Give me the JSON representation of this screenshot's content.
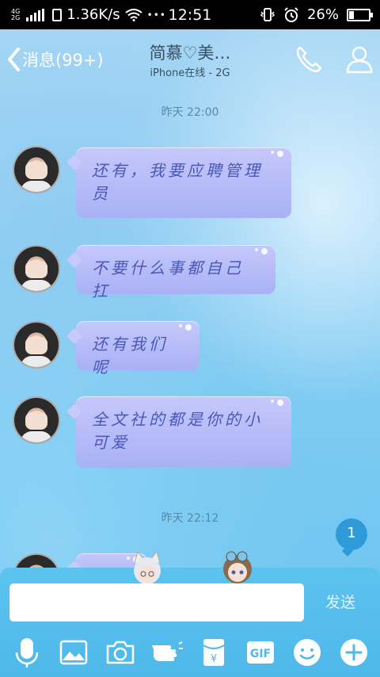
{
  "status_bar": {
    "network_top": "4G",
    "network_bottom": "2G",
    "speed": "1.36K/s",
    "dots": "•••",
    "time": "12:51",
    "battery": "26%",
    "battery_level": 0.26
  },
  "header": {
    "back_label": "消息(99+)",
    "title": "简慕♡美…",
    "subtitle": "iPhone在线 - 2G"
  },
  "chat": {
    "timestamp_1": "昨天 22:00",
    "messages": [
      {
        "text": "还有，我要应聘管理员"
      },
      {
        "text": "不要什么事都自己扛"
      },
      {
        "text": "还有我们呢"
      },
      {
        "text": "全文社的都是你的小可爱"
      }
    ],
    "timestamp_2": "昨天 22:12",
    "unread_count": "1"
  },
  "input": {
    "value": "",
    "send_label": "发送",
    "gif_label": "GIF",
    "redpacket_symbol": "¥"
  },
  "colors": {
    "accent": "#4eb8ea",
    "bubble": "#b4baf8",
    "bubble_text": "#4a58b6",
    "unread": "#2e9bd8"
  },
  "icons": [
    "back-chevron-icon",
    "phone-icon",
    "profile-icon",
    "microphone-icon",
    "image-icon",
    "camera-icon",
    "hand-icon",
    "red-packet-icon",
    "gif-icon",
    "emoji-icon",
    "plus-icon"
  ]
}
